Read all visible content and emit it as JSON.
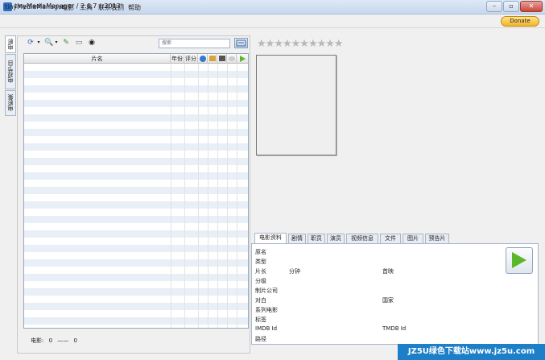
{
  "window": {
    "title": "tinyMediaManager / 2.6.7 (r2013)",
    "minimize": "–",
    "maximize": "▫",
    "close": "✕"
  },
  "menu": {
    "items": [
      "tinyMediaManager",
      "电影",
      "工具",
      "联系我们",
      "帮助"
    ],
    "donate": "Donate"
  },
  "sidebar": {
    "tabs": [
      "电影",
      "电视节目",
      "电影集"
    ]
  },
  "toolbar": {
    "icons": [
      "refresh-icon",
      "search-scrape-icon",
      "edit-icon",
      "rename-icon",
      "media-info-icon"
    ],
    "search_placeholder": "搜索"
  },
  "movie_table": {
    "columns": [
      "片名",
      "年份",
      "评分"
    ],
    "status_icons": [
      "info-icon",
      "images-icon",
      "film-icon",
      "subtitle-icon",
      "play-icon"
    ],
    "row_count_visible": 37
  },
  "status": {
    "movies_label": "电影:",
    "count": "0",
    "separator": "——",
    "total": "0"
  },
  "rating": {
    "stars": 10,
    "value": 0
  },
  "detail_tabs": [
    "电影资料",
    "剧情",
    "职员",
    "演员",
    "视频信息",
    "文件",
    "图片",
    "预告片"
  ],
  "details": {
    "fields": [
      {
        "label": "原名",
        "value": ""
      },
      {
        "label": "类型",
        "value": ""
      },
      {
        "label": "片长",
        "value": "分钟"
      },
      {
        "label": "分级",
        "value": ""
      },
      {
        "label": "制片公司",
        "value": ""
      },
      {
        "label": "对白",
        "value": ""
      },
      {
        "label": "系列电影",
        "value": ""
      },
      {
        "label": "标签",
        "value": ""
      },
      {
        "label": "IMDB Id",
        "value": ""
      },
      {
        "label": "路径",
        "value": ""
      }
    ],
    "right_fields": [
      {
        "label": "首映",
        "value": ""
      },
      {
        "label": "国家",
        "value": ""
      },
      {
        "label": "TMDB Id",
        "value": ""
      }
    ]
  },
  "watermark": "JZ5U绿色下载站www.jz5u.com",
  "colors": {
    "titlebar": "#c7d8ee",
    "donate": "#f2b52b",
    "play": "#5cb82a",
    "watermark": "#1d7fc7"
  }
}
